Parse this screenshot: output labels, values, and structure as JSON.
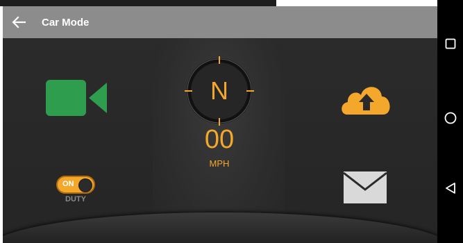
{
  "app": {
    "title": "Car Mode"
  },
  "compass": {
    "heading": "N"
  },
  "speed": {
    "value": "00",
    "unit": "MPH"
  },
  "duty_toggle": {
    "state_label": "ON",
    "label": "DUTY",
    "on": true
  },
  "colors": {
    "accent": "#f3a82b",
    "video_green": "#2e9d4e",
    "app_bar": "#8c8c8c",
    "dashboard": "#2a2a2a",
    "nav_bar": "#000000"
  },
  "icons": {
    "back": "arrow-left-icon",
    "video": "video-camera-icon",
    "upload": "cloud-upload-icon",
    "mail": "envelope-icon",
    "recents": "square-icon",
    "home": "circle-icon",
    "back_nav": "triangle-back-icon"
  }
}
